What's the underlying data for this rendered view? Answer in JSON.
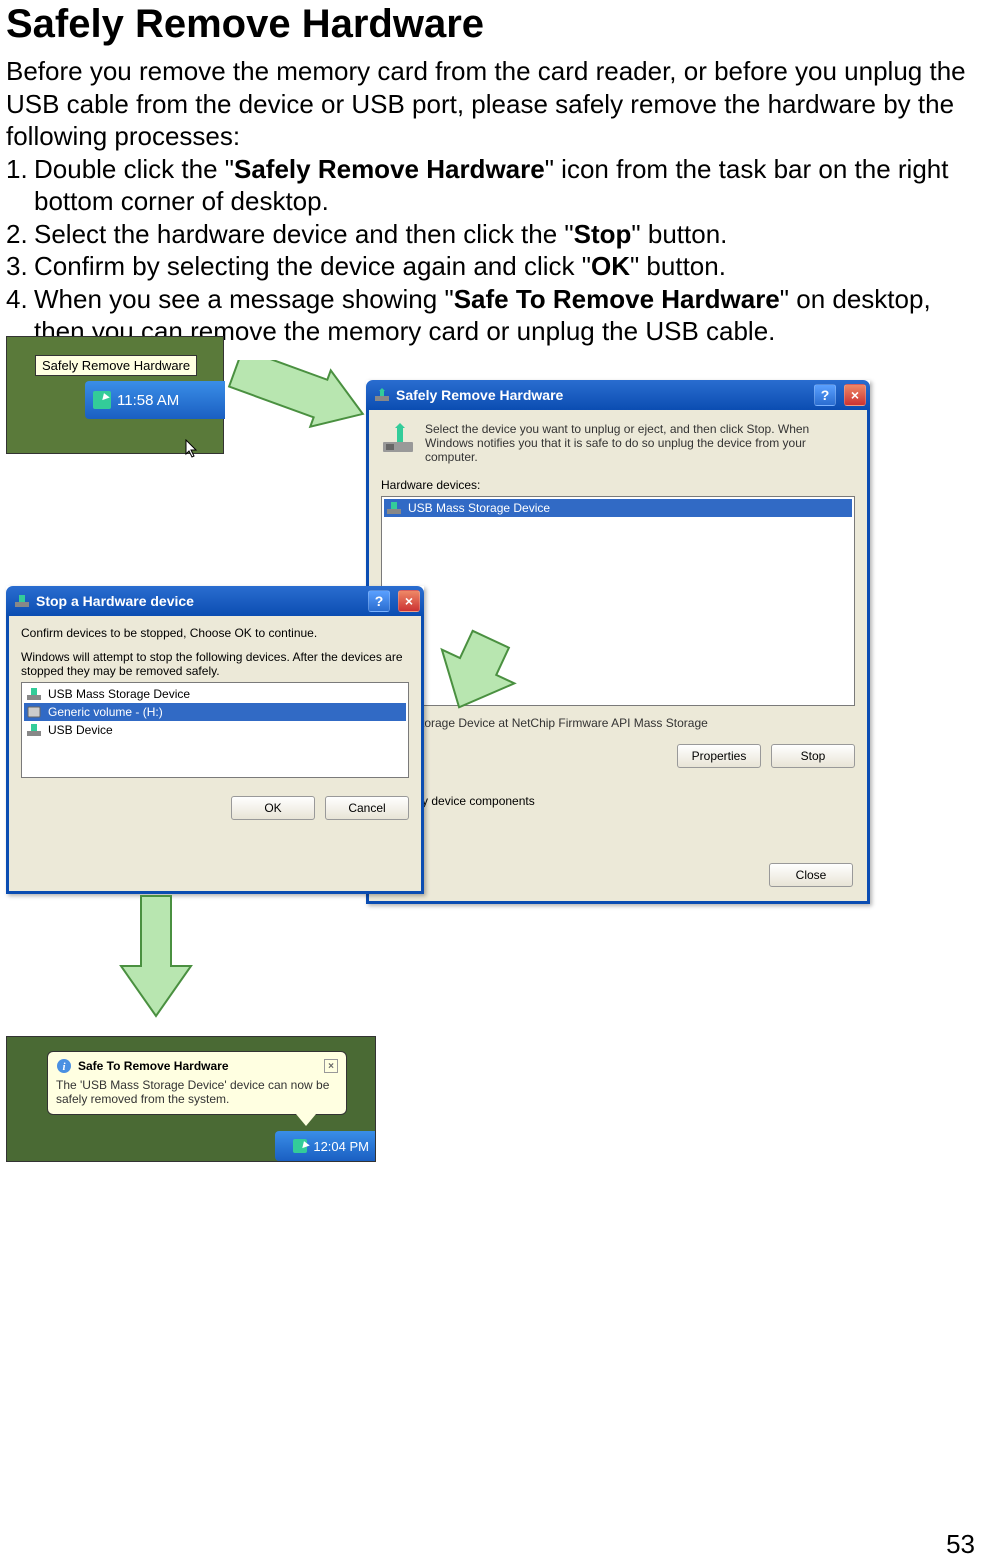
{
  "doc": {
    "title": "Safely Remove Hardware",
    "intro": "Before you remove the memory card from the card reader, or before you unplug the USB cable from the device or USB port, please safely remove the hardware by the following processes:",
    "steps": {
      "s1a": "Double click the \"",
      "s1b": "Safely Remove Hardware",
      "s1c": "\" icon from the task bar on the right bottom corner of desktop.",
      "s2a": "Select the hardware device and then click the \"",
      "s2b": "Stop",
      "s2c": "\" button.",
      "s3a": "Confirm by selecting the device again and click \"",
      "s3b": "OK",
      "s3c": "\" button.",
      "s4a": "When you see a message showing \"",
      "s4b": "Safe To Remove Hardware",
      "s4c": "\" on desktop, then you can remove the memory card or unplug the USB cable."
    },
    "page_number": "53"
  },
  "fig_taskbar": {
    "tooltip": "Safely Remove Hardware",
    "clock": "11:58 AM"
  },
  "dlg_remove": {
    "title": "Safely Remove Hardware",
    "desc": "Select the device you want to unplug or eject, and then click Stop. When Windows notifies you that it is safe to do so unplug the device from your computer.",
    "label": "Hardware devices:",
    "item": "USB Mass Storage Device",
    "detail": "Mass Storage Device at NetChip Firmware API Mass Storage",
    "btn_properties": "Properties",
    "btn_stop": "Stop",
    "chk_label": "splay device components",
    "btn_close": "Close"
  },
  "dlg_stop": {
    "title": "Stop a Hardware device",
    "line1": "Confirm devices to be stopped, Choose OK to continue.",
    "line2": "Windows will attempt to stop the following devices. After the devices are stopped they may be removed safely.",
    "items": [
      "USB Mass Storage Device",
      "Generic volume - (H:)",
      "USB Device"
    ],
    "btn_ok": "OK",
    "btn_cancel": "Cancel"
  },
  "fig_notify": {
    "title": "Safe To Remove Hardware",
    "body": "The 'USB Mass Storage Device' device can now be safely removed from the system.",
    "clock": "12:04 PM"
  }
}
